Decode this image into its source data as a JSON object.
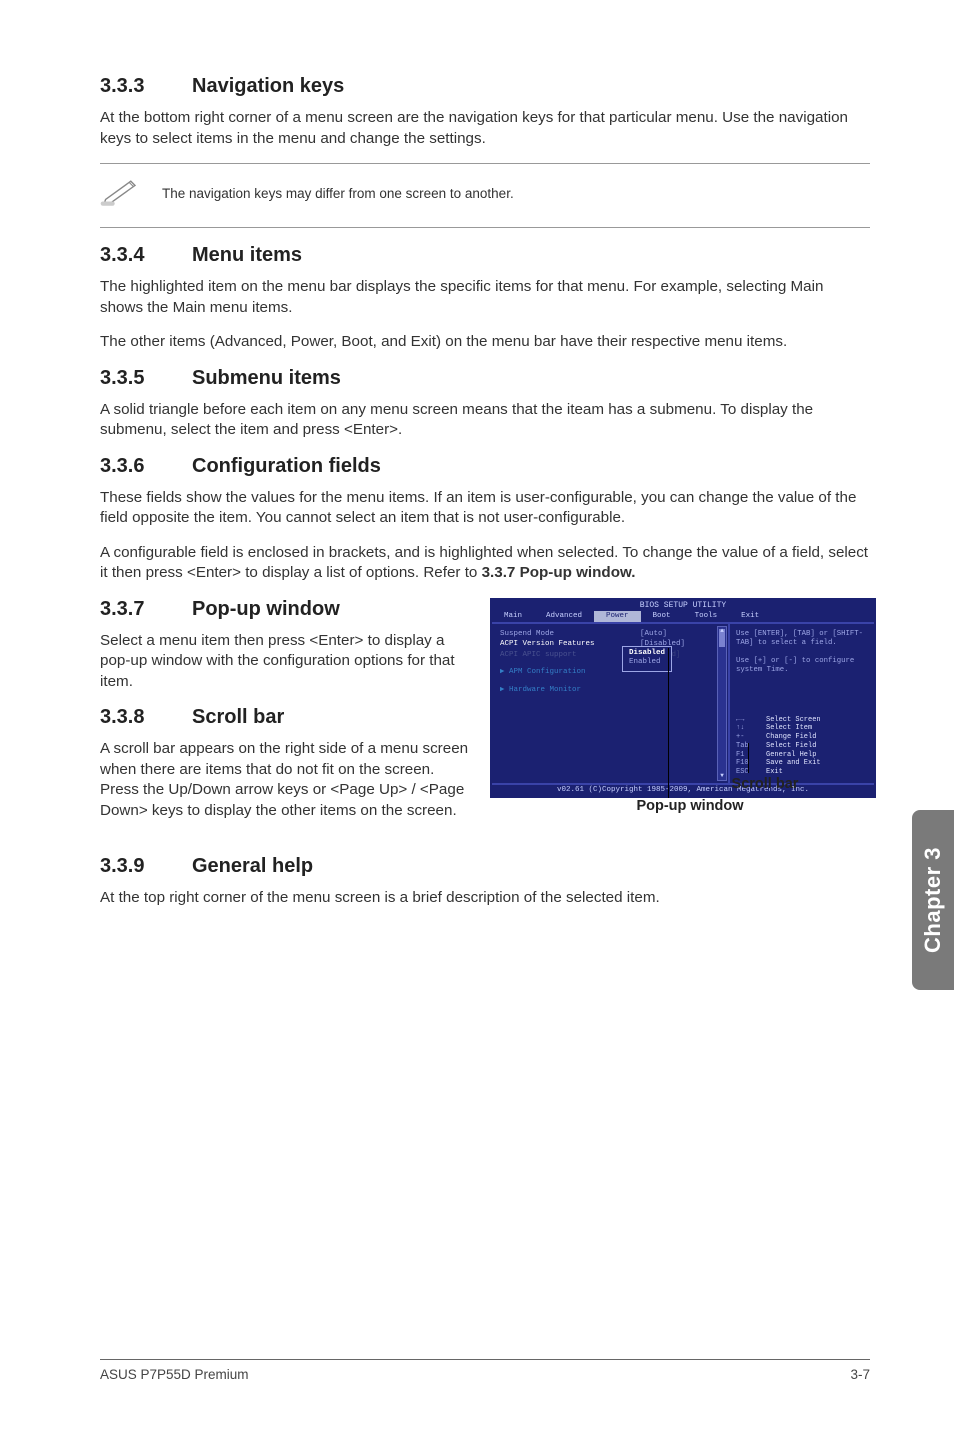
{
  "sections": {
    "s333": {
      "num": "3.3.3",
      "title": "Navigation keys",
      "p1": "At the bottom right corner of a menu screen are the navigation keys for that particular menu. Use the navigation keys to select items in the menu and change the settings.",
      "note": "The navigation keys may differ from one screen to another."
    },
    "s334": {
      "num": "3.3.4",
      "title": "Menu items",
      "p1": "The highlighted item on the menu bar displays the specific items for that menu. For example, selecting Main shows the Main menu items.",
      "p2": "The other items (Advanced, Power, Boot, and Exit) on the menu bar have their respective menu items."
    },
    "s335": {
      "num": "3.3.5",
      "title": "Submenu items",
      "p1": "A solid triangle before each item on any menu screen means that the iteam has a submenu. To display the submenu, select the item and press <Enter>."
    },
    "s336": {
      "num": "3.3.6",
      "title": "Configuration fields",
      "p1": "These fields show the values for the menu items. If an item is user-configurable, you can change the value of the field opposite the item. You cannot select an item that is not user-configurable.",
      "p2a": "A configurable field is enclosed in brackets, and is highlighted when selected. To change the value of a field, select it then press <Enter> to display a list of options. Refer to ",
      "p2b": "3.3.7 Pop-up window."
    },
    "s337": {
      "num": "3.3.7",
      "title": "Pop-up window",
      "p1": "Select a menu item then press <Enter> to display a pop-up window with the configuration options for that item."
    },
    "s338": {
      "num": "3.3.8",
      "title": "Scroll bar",
      "p1": "A scroll bar appears on the right side of a menu screen when there are items that do not fit on the screen. Press the Up/Down arrow keys or <Page Up> / <Page Down> keys to display the other items on the screen."
    },
    "s339": {
      "num": "3.3.9",
      "title": "General help",
      "p1": "At the top right corner of the menu screen is a brief description of the selected item."
    }
  },
  "bios": {
    "title": "BIOS SETUP UTILITY",
    "tabs": [
      "Main",
      "Advanced",
      "Power",
      "Boot",
      "Tools",
      "Exit"
    ],
    "active_tab_index": 2,
    "left_items": [
      {
        "label": "Suspend Mode",
        "value": "[Auto]"
      },
      {
        "label": "ACPI Version Features",
        "value": "[Disabled]"
      },
      {
        "label": "ACPI APIC support",
        "value": "[Enabled]"
      }
    ],
    "popup": {
      "options": [
        "Disabled",
        "Enabled"
      ],
      "selected_index": 0
    },
    "sub_items": [
      "APM Configuration",
      "Hardware Monitor"
    ],
    "help_top": "Use [ENTER], [TAB] or [SHIFT-TAB] to select a field.\n\nUse [+] or [-] to configure system Time.",
    "keys": [
      {
        "k": "←→",
        "d": "Select Screen"
      },
      {
        "k": "↑↓",
        "d": "Select Item"
      },
      {
        "k": "+-",
        "d": "Change Field"
      },
      {
        "k": "Tab",
        "d": "Select Field"
      },
      {
        "k": "F1",
        "d": "General Help"
      },
      {
        "k": "F10",
        "d": "Save and Exit"
      },
      {
        "k": "ESC",
        "d": "Exit"
      }
    ],
    "footer": "v02.61 (C)Copyright 1985-2009, American Megatrends, Inc.",
    "label_scroll": "Scroll bar",
    "label_popup": "Pop-up window"
  },
  "chapter_tab": "Chapter 3",
  "footer_left": "ASUS P7P55D Premium",
  "footer_right": "3-7"
}
